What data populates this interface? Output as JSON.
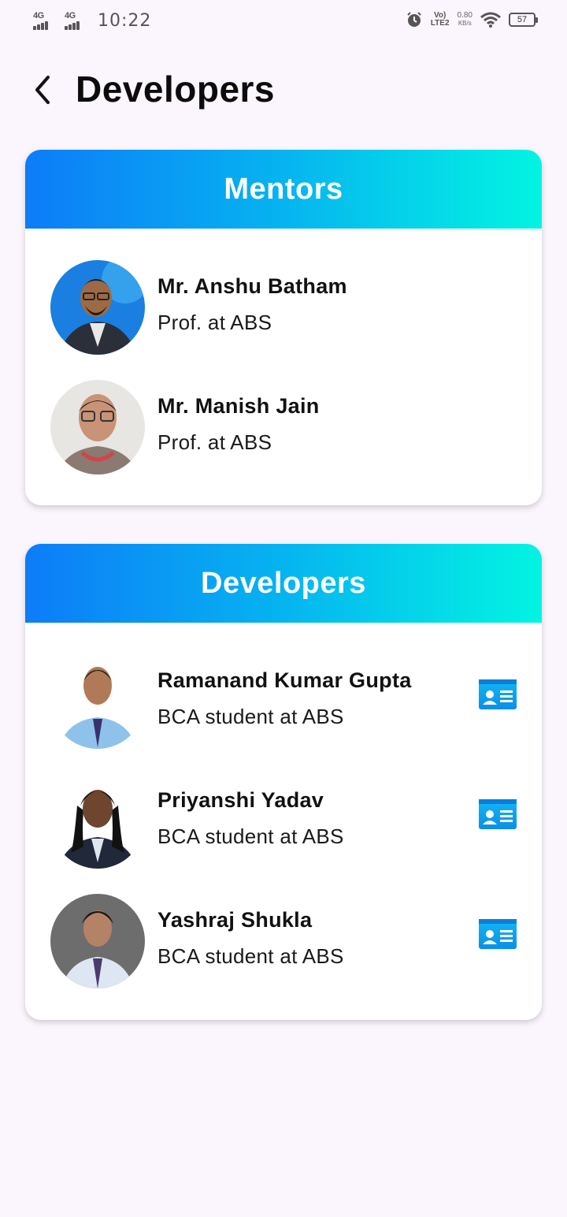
{
  "status_bar": {
    "sim1": "4G",
    "sim2": "4G",
    "time": "10:22",
    "volte_top": "Vo)",
    "volte_bottom": "LTE2",
    "speed_value": "0.80",
    "speed_unit": "KB/s",
    "battery": "57"
  },
  "header": {
    "title": "Developers",
    "back_icon": "chevron-left-icon"
  },
  "mentors": {
    "title": "Mentors",
    "people": [
      {
        "name": "Mr. Anshu Batham",
        "role": "Prof. at ABS"
      },
      {
        "name": "Mr. Manish Jain",
        "role": "Prof. at ABS"
      }
    ]
  },
  "developers": {
    "title": "Developers",
    "people": [
      {
        "name": "Ramanand Kumar Gupta",
        "role": "BCA student at ABS",
        "action_icon": "id-card-icon"
      },
      {
        "name": "Priyanshi Yadav",
        "role": "BCA student at ABS",
        "action_icon": "id-card-icon"
      },
      {
        "name": "Yashraj Shukla",
        "role": "BCA student at ABS",
        "action_icon": "id-card-icon"
      }
    ]
  },
  "colors": {
    "gradient_start": "#0d7cf8",
    "gradient_end": "#02f4e2",
    "background": "#fbf5fd",
    "id_icon": "#0aa0f0"
  }
}
